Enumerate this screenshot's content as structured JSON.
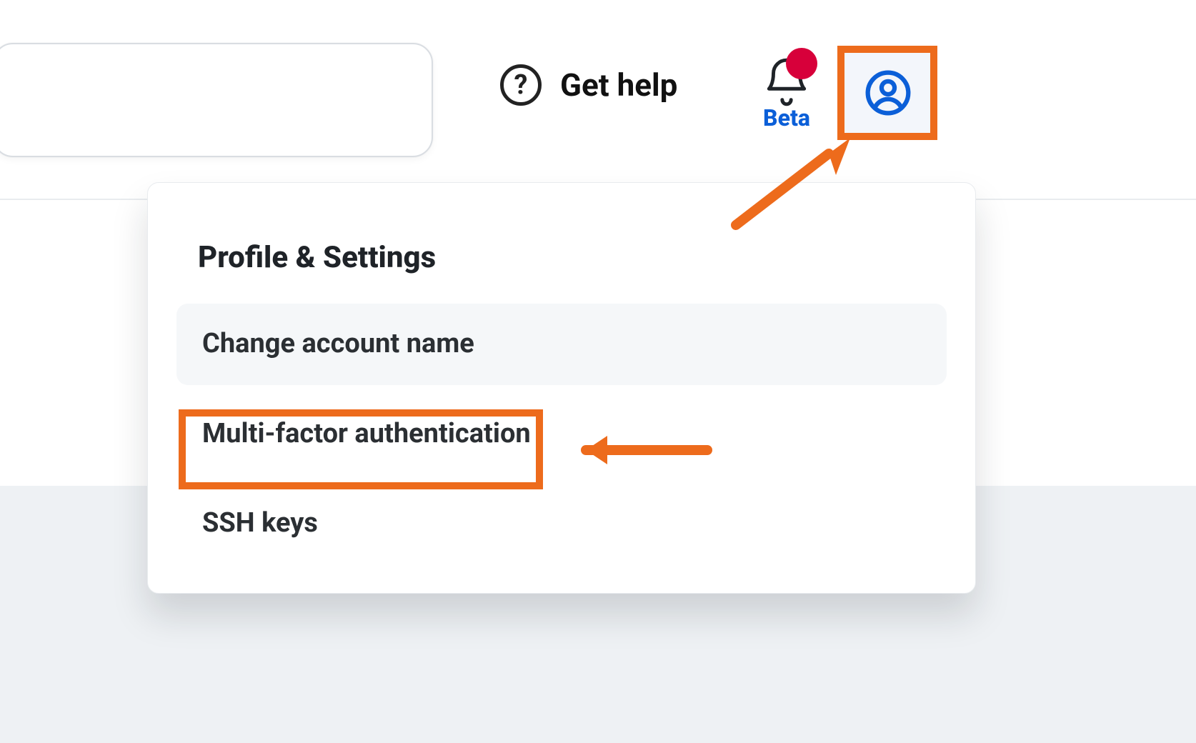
{
  "header": {
    "help_label": "Get help",
    "notifications_beta_label": "Beta"
  },
  "profile_menu": {
    "title": "Profile & Settings",
    "items": [
      {
        "label": "Change account name",
        "hover": true
      },
      {
        "label": "Multi-factor authentication",
        "hover": false
      },
      {
        "label": "SSH keys",
        "hover": false
      }
    ]
  },
  "annotations": {
    "highlight_color": "#ed6b1c"
  }
}
